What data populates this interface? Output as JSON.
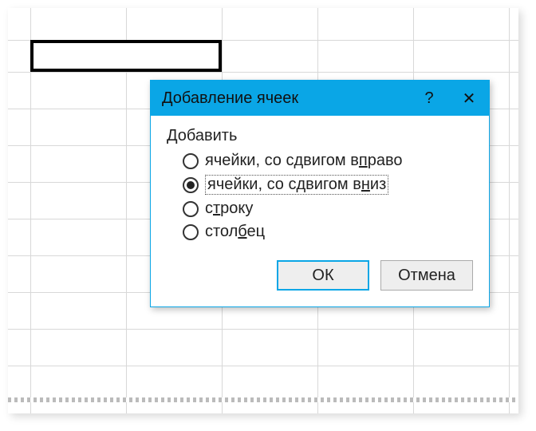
{
  "dialog": {
    "title": "Добавление ячеек",
    "help_glyph": "?",
    "close_glyph": "✕",
    "group_label": "Добавить",
    "options": {
      "shift_right": {
        "label_before": "ячейки, со сдвигом в",
        "label_underline": "п",
        "label_after": "раво",
        "checked": false
      },
      "shift_down": {
        "label_before": "ячейки, со сдвигом в",
        "label_underline": "н",
        "label_after": "из",
        "checked": true
      },
      "row": {
        "label_before": "с",
        "label_underline": "т",
        "label_after": "року",
        "checked": false
      },
      "col": {
        "label_before": "стол",
        "label_underline": "б",
        "label_after": "ец",
        "checked": false
      }
    },
    "ok_label": "ОК",
    "cancel_label": "Отмена"
  },
  "colors": {
    "accent": "#0aa6e6"
  }
}
